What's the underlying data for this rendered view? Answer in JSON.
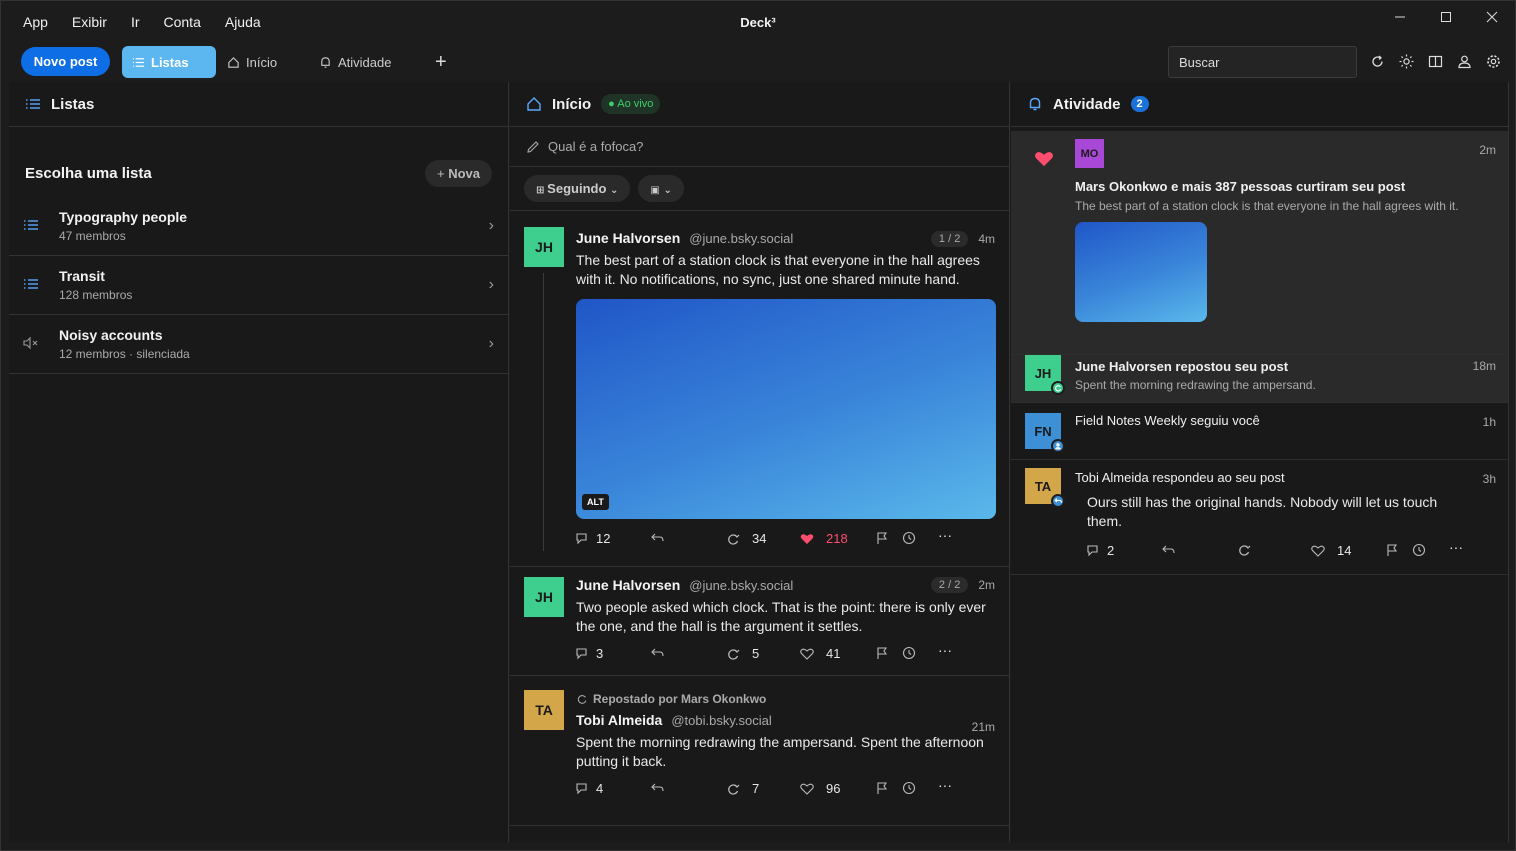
{
  "app": {
    "title": "Deck³",
    "menu": [
      "App",
      "Exibir",
      "Ir",
      "Conta",
      "Ajuda"
    ],
    "window_controls": [
      "minimize-icon",
      "maximize-icon",
      "close-icon"
    ]
  },
  "toolbar": {
    "new_post": "Novo post",
    "tabs": [
      {
        "label": "Listas",
        "icon": "list-icon",
        "active": true
      },
      {
        "label": "Início",
        "icon": "home-icon",
        "active": false
      },
      {
        "label": "Atividade",
        "icon": "bell-icon",
        "active": false
      }
    ],
    "add_tab": "+",
    "search_placeholder": "Buscar",
    "icons": [
      "refresh-icon",
      "theme-icon",
      "columns-icon",
      "account-icon",
      "settings-icon"
    ]
  },
  "lists_column": {
    "title": "Listas",
    "heading": "Escolha uma lista",
    "new_button": "Nova",
    "items": [
      {
        "name": "Typography people",
        "sub": "47 membros",
        "icon": "list-icon"
      },
      {
        "name": "Transit",
        "sub": "128 membros",
        "icon": "list-icon"
      },
      {
        "name": "Noisy accounts",
        "sub": "12 membros · silenciada",
        "icon": "mute-icon"
      }
    ]
  },
  "home_column": {
    "title": "Início",
    "live": "Ao vivo",
    "compose_placeholder": "Qual é a fofoca?",
    "filter_label": "Seguindo",
    "posts": [
      {
        "initials": "JH",
        "avatar_color": "#3ecf8e",
        "name": "June Halvorsen",
        "handle": "@june.bsky.social",
        "thread": "1 / 2",
        "time": "4m",
        "text": "The best part of a station clock is that everyone in the hall agrees with it. No notifications, no sync, just one shared minute hand.",
        "alt": "ALT",
        "replies": "12",
        "reposts": "34",
        "likes": "218",
        "liked": true
      },
      {
        "initials": "JH",
        "avatar_color": "#3ecf8e",
        "name": "June Halvorsen",
        "handle": "@june.bsky.social",
        "thread": "2 / 2",
        "time": "2m",
        "text": "Two people asked which clock. That is the point: there is only ever the one, and the hall is the argument it settles.",
        "replies": "3",
        "reposts": "5",
        "likes": "41",
        "liked": false
      },
      {
        "initials": "TA",
        "avatar_color": "#d4a64a",
        "reposted_by": "Repostado por Mars Okonkwo",
        "name": "Tobi Almeida",
        "handle": "@tobi.bsky.social",
        "time": "21m",
        "text": "Spent the morning redrawing the ampersand. Spent the afternoon putting it back.",
        "replies": "4",
        "reposts": "7",
        "likes": "96",
        "liked": false
      }
    ]
  },
  "activity_column": {
    "title": "Atividade",
    "badge": "2",
    "items": [
      {
        "initials": "MO",
        "avatar_color": "#a947d6",
        "title": "Mars Okonkwo e mais 387 pessoas curtiram seu post",
        "sub": "The best part of a station clock is that everyone in the hall agrees with it.",
        "time": "2m"
      },
      {
        "initials": "JH",
        "avatar_color": "#3ecf8e",
        "title": "June Halvorsen repostou seu post",
        "sub": "Spent the morning redrawing the ampersand.",
        "time": "18m"
      },
      {
        "initials": "FN",
        "avatar_color": "#3d8fd6",
        "title": "Field Notes Weekly seguiu você",
        "time": "1h"
      },
      {
        "initials": "TA",
        "avatar_color": "#d4a64a",
        "title": "Tobi Almeida respondeu ao seu post",
        "quote": "Ours still has the original hands. Nobody will let us touch them.",
        "time": "3h",
        "replies": "2",
        "likes": "14"
      }
    ]
  },
  "colors": {
    "accent": "#0d6ee6",
    "active_tab": "#5cb7f0",
    "like": "#ff4d6d",
    "live": "#3fcf6a"
  }
}
